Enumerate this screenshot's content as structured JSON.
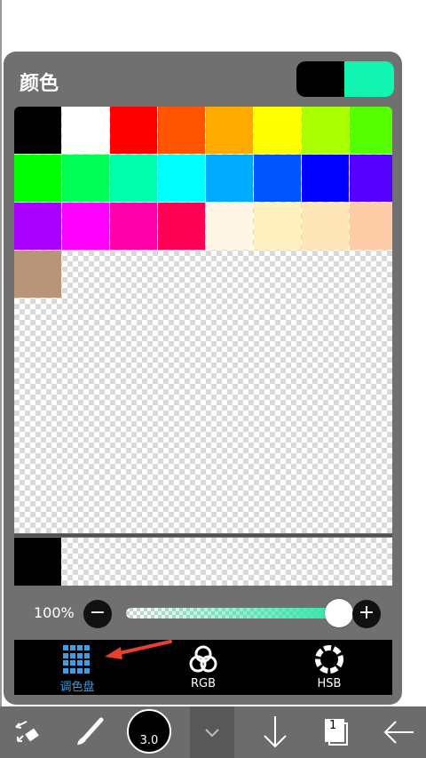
{
  "panel": {
    "title": "颜色",
    "current_fg": "#000000",
    "current_bg": "#11f5b0"
  },
  "palette": {
    "colors": [
      "#000000",
      "#ffffff",
      "#ff0000",
      "#ff5500",
      "#ffaa00",
      "#ffff00",
      "#aaff00",
      "#55ff00",
      "#00ff00",
      "#00ff55",
      "#00ffaa",
      "#00ffff",
      "#00aaff",
      "#0055ff",
      "#0000ff",
      "#5500ff",
      "#aa00ff",
      "#ff00ff",
      "#ff00aa",
      "#ff0055",
      "#fff6e6",
      "#fff0c0",
      "#ffe6b8",
      "#ffcca8",
      "#b8947a"
    ]
  },
  "history": {
    "colors": [
      "#000000"
    ]
  },
  "opacity": {
    "label": "100%",
    "minus_icon": "minus-icon",
    "plus_icon": "plus-icon",
    "value": 1.0,
    "fill_color": "#2ee6a6"
  },
  "tabs": [
    {
      "label": "调色盘",
      "icon": "grid-icon",
      "active": true
    },
    {
      "label": "RGB",
      "icon": "rgb-circles-icon",
      "active": false
    },
    {
      "label": "HSB",
      "icon": "hsb-ring-icon",
      "active": false
    }
  ],
  "toolbar": {
    "brush_size": "3.0",
    "page_number": "1",
    "items": [
      "transform-icon",
      "brush-icon",
      "brush-size",
      "chevron-down-icon",
      "arrow-down-icon",
      "layers-icon",
      "arrow-left-icon"
    ]
  },
  "annotation_color": "#e8402a"
}
